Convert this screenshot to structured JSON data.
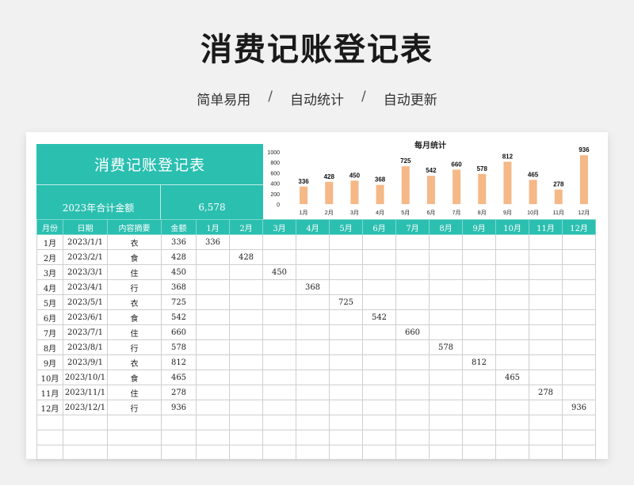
{
  "page": {
    "title": "消费记账登记表",
    "features": [
      "简单易用",
      "自动统计",
      "自动更新"
    ],
    "separator": "/"
  },
  "banner": {
    "title": "消费记账登记表",
    "total_label": "2023年合计金额",
    "total_value": "6,578",
    "color": "#2bbfb0"
  },
  "table": {
    "headers": [
      "月份",
      "日期",
      "内容摘要",
      "金额",
      "1月",
      "2月",
      "3月",
      "4月",
      "5月",
      "6月",
      "7月",
      "8月",
      "9月",
      "10月",
      "11月",
      "12月"
    ],
    "rows": [
      {
        "month": "1月",
        "date": "2023/1/1",
        "summary": "衣",
        "amount": "336"
      },
      {
        "month": "2月",
        "date": "2023/2/1",
        "summary": "食",
        "amount": "428"
      },
      {
        "month": "3月",
        "date": "2023/3/1",
        "summary": "住",
        "amount": "450"
      },
      {
        "month": "4月",
        "date": "2023/4/1",
        "summary": "行",
        "amount": "368"
      },
      {
        "month": "5月",
        "date": "2023/5/1",
        "summary": "衣",
        "amount": "725"
      },
      {
        "month": "6月",
        "date": "2023/6/1",
        "summary": "食",
        "amount": "542"
      },
      {
        "month": "7月",
        "date": "2023/7/1",
        "summary": "住",
        "amount": "660"
      },
      {
        "month": "8月",
        "date": "2023/8/1",
        "summary": "行",
        "amount": "578"
      },
      {
        "month": "9月",
        "date": "2023/9/1",
        "summary": "衣",
        "amount": "812"
      },
      {
        "month": "10月",
        "date": "2023/10/1",
        "summary": "食",
        "amount": "465"
      },
      {
        "month": "11月",
        "date": "2023/11/1",
        "summary": "住",
        "amount": "278"
      },
      {
        "month": "12月",
        "date": "2023/12/1",
        "summary": "行",
        "amount": "936"
      }
    ],
    "empty_rows": 3
  },
  "chart_data": {
    "type": "bar",
    "title": "每月统计",
    "categories": [
      "1月",
      "2月",
      "3月",
      "4月",
      "5月",
      "6月",
      "7月",
      "8月",
      "9月",
      "10月",
      "11月",
      "12月"
    ],
    "values": [
      336,
      428,
      450,
      368,
      725,
      542,
      660,
      578,
      812,
      465,
      278,
      936
    ],
    "ylim": [
      0,
      1000
    ],
    "yticks": [
      0,
      200,
      400,
      600,
      800,
      1000
    ],
    "bar_color": "#f5b887",
    "grid": false,
    "legend": "none"
  }
}
